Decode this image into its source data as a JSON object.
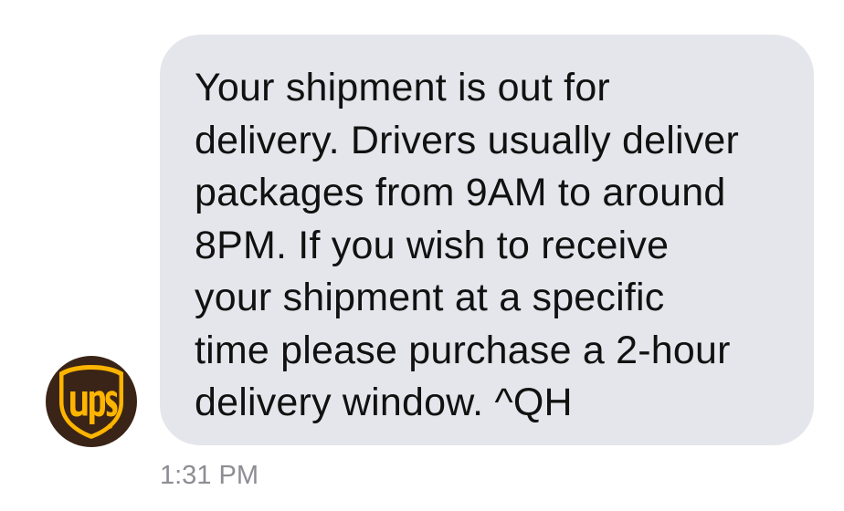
{
  "conversation": {
    "sender_avatar": {
      "icon": "ups-logo-icon",
      "logo_text": "ups",
      "colors": {
        "background": "#3a2417",
        "shield": "#ffb500"
      }
    },
    "message": {
      "text": "Your shipment is out for\ndelivery. Drivers usually deliver\npackages from 9AM to around\n8PM. If you wish to receive\nyour shipment at a specific\ntime please purchase a 2-hour\ndelivery window. ^QH",
      "bubble_color": "#e5e6eb"
    },
    "timestamp": "1:31 PM"
  }
}
